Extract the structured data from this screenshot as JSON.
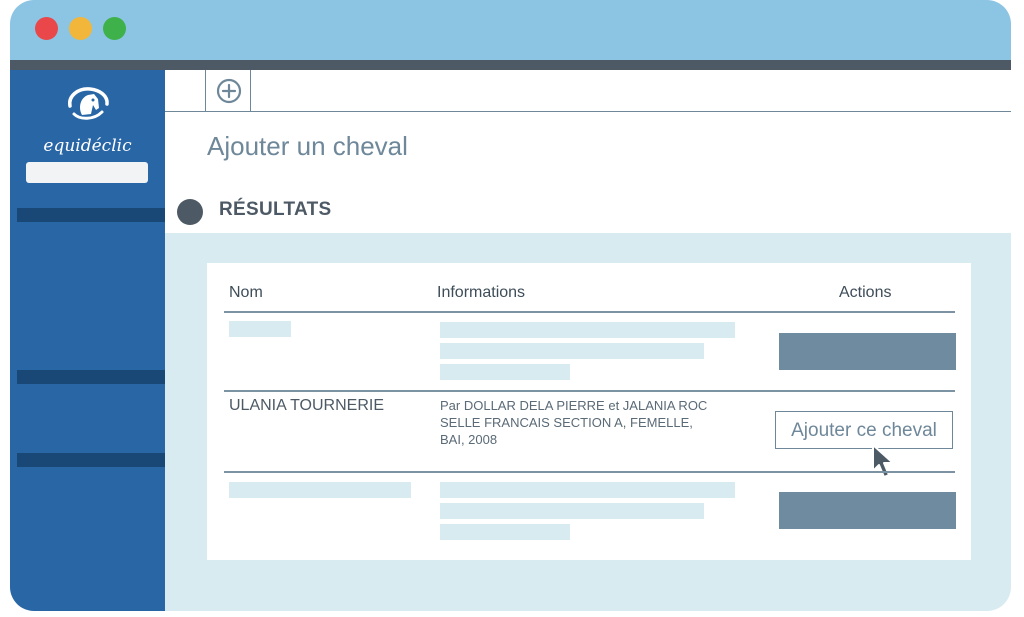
{
  "window": {
    "controls": [
      "close",
      "minimize",
      "maximize"
    ]
  },
  "sidebar": {
    "logo_text": "equidéclic",
    "logo_icon": "horse-head-logo-icon"
  },
  "tabs": {
    "add_icon": "plus-circle-icon"
  },
  "page": {
    "title": "Ajouter un cheval"
  },
  "results": {
    "title": "RÉSULTATS",
    "columns": [
      "Nom",
      "Informations",
      "Actions"
    ],
    "rows": [
      {
        "name": "ULANIA TOURNERIE",
        "info_lines": [
          "Par DOLLAR DELA PIERRE et JALANIA ROC",
          "SELLE FRANCAIS SECTION A, FEMELLE,",
          "BAI, 2008"
        ],
        "action_label": "Ajouter ce cheval"
      }
    ]
  },
  "colors": {
    "titlebar": "#8cc4e3",
    "sidebar": "#2866a6",
    "accent_text": "#6e8799",
    "results_background": "#d7ebf0"
  }
}
